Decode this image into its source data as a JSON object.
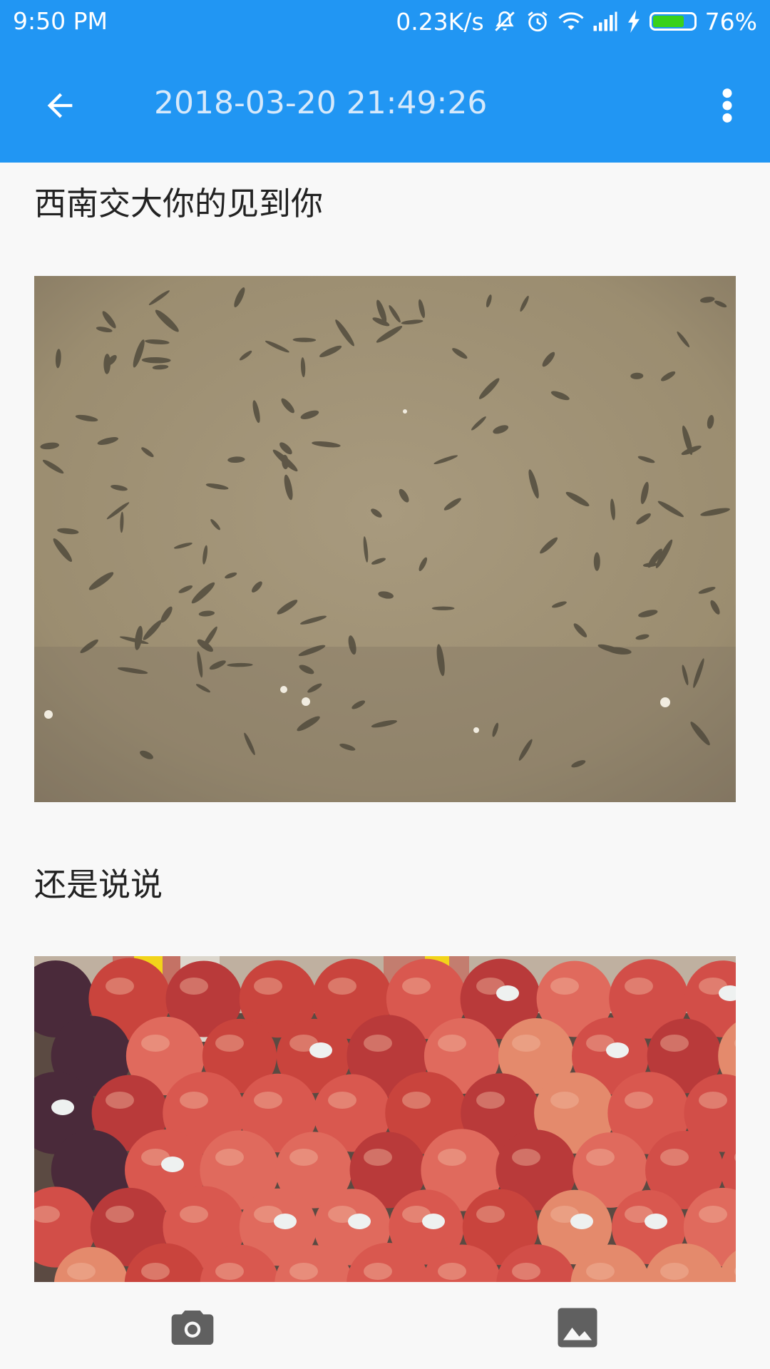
{
  "status_bar": {
    "time": "9:50  PM",
    "network_speed": "0.23K/s",
    "battery_percent": "76%",
    "battery_level": 0.76,
    "icons": [
      "mute-icon",
      "alarm-icon",
      "wifi-icon",
      "signal-icon",
      "charging-icon",
      "battery-icon"
    ]
  },
  "app_bar": {
    "title": "2018-03-20 21:49:26",
    "back_icon": "arrow-back-icon",
    "menu_icon": "more-vert-icon"
  },
  "content": {
    "items": [
      {
        "type": "text",
        "text": "西南交大你的见到你"
      },
      {
        "type": "image",
        "subject": "fish-in-water-photo"
      },
      {
        "type": "text",
        "text": "还是说说"
      },
      {
        "type": "image",
        "subject": "red-fruits-photo"
      }
    ]
  },
  "bottom_bar": {
    "camera_icon": "camera-icon",
    "gallery_icon": "image-icon"
  },
  "colors": {
    "primary": "#2196f3",
    "background": "#f8f8f8",
    "battery_fill": "#39d11b",
    "icon_gray": "#606060"
  }
}
